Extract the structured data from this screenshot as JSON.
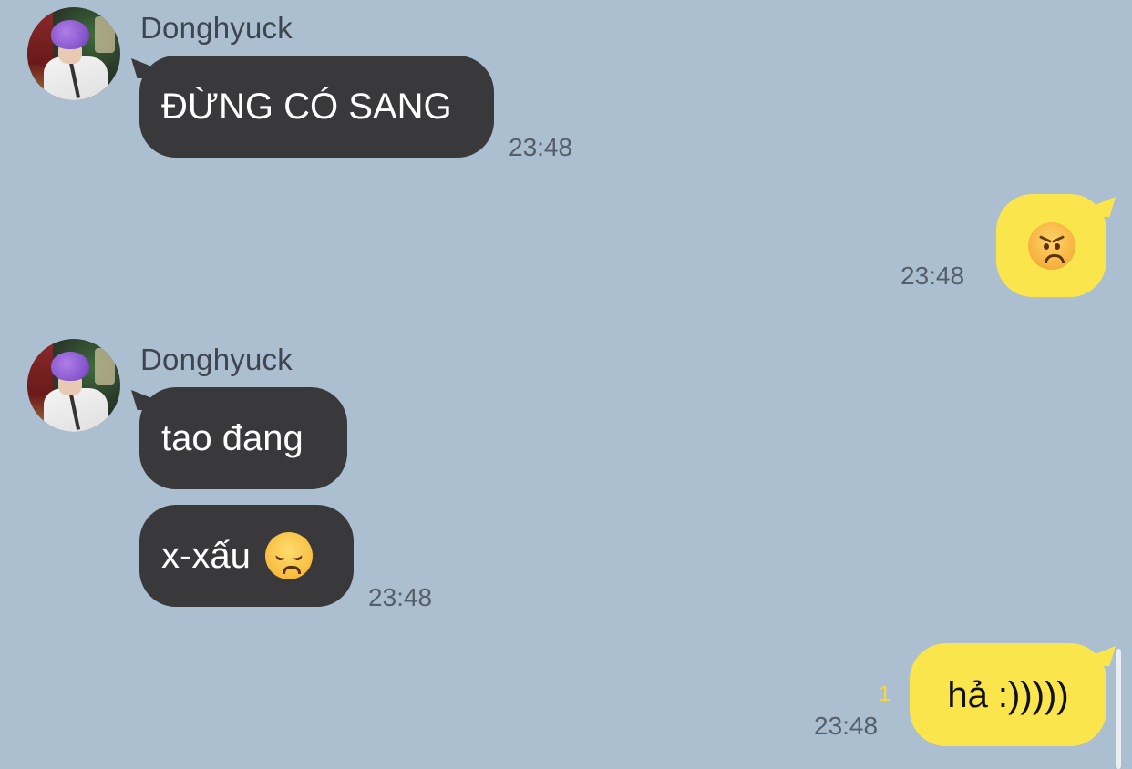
{
  "messages": [
    {
      "sender": "Donghyuck",
      "text": "ĐỪNG CÓ SANG",
      "time": "23:48"
    },
    {
      "outgoing_emoji": "angry-face-emoji",
      "time": "23:48"
    },
    {
      "sender": "Donghyuck",
      "text": "tao đang",
      "text2": "x-xấu",
      "emoji": "disappointed-face-emoji",
      "time": "23:48"
    },
    {
      "text": "hả :)))))",
      "unread_count": "1",
      "time": "23:48"
    }
  ],
  "colors": {
    "background": "#abbfd0",
    "incoming_bubble": "#39393b",
    "outgoing_bubble": "#fbe54d",
    "unread": "#f5d83a"
  }
}
